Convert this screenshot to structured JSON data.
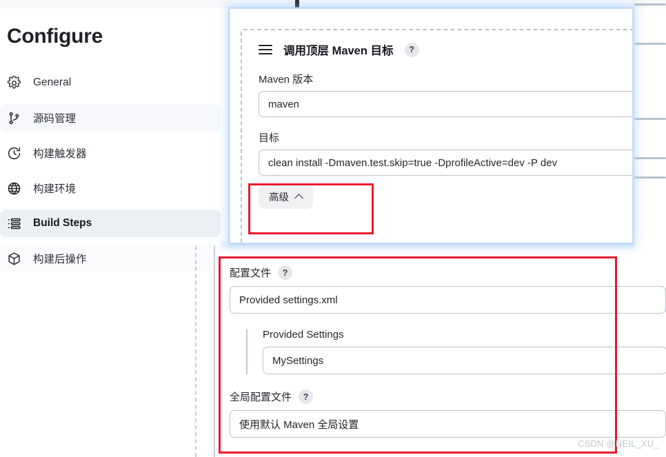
{
  "colors": {
    "accent_red": "#e8192c",
    "panel_focus_blue": "#cfe0f7",
    "selected_nav_bg": "#eceff3",
    "text_primary": "#1f2328",
    "field_border": "#b9c3cc"
  },
  "sidebar": {
    "title": "Configure",
    "items": [
      {
        "label": "General",
        "icon": "gear-icon",
        "selected": false,
        "state": ""
      },
      {
        "label": "源码管理",
        "icon": "git-branch-icon",
        "selected": false,
        "state": "hover-a"
      },
      {
        "label": "构建触发器",
        "icon": "clock-icon",
        "selected": false,
        "state": ""
      },
      {
        "label": "构建环境",
        "icon": "globe-icon",
        "selected": false,
        "state": ""
      },
      {
        "label": "Build Steps",
        "icon": "list-icon",
        "selected": true,
        "state": "selected"
      },
      {
        "label": "构建后操作",
        "icon": "package-icon",
        "selected": false,
        "state": "hover-b"
      }
    ]
  },
  "panel": {
    "drag_handle_icon": "hamburger-drag-icon",
    "title": "调用顶层 Maven 目标",
    "help_badge": "?",
    "fields": [
      {
        "label": "Maven 版本",
        "value": "maven"
      },
      {
        "label": "目标",
        "value": "clean install -Dmaven.test.skip=true -DprofileActive=dev -P dev"
      }
    ],
    "advanced_button": {
      "label": "高级",
      "icon": "chevron-up-icon"
    }
  },
  "ghost_row": {
    "checkbox_label": ""
  },
  "settings_section": {
    "config_file": {
      "label": "配置文件",
      "help_badge": "?",
      "value": "Provided settings.xml"
    },
    "provided_settings": {
      "label": "Provided Settings",
      "value": "MySettings"
    },
    "global_config_file": {
      "label": "全局配置文件",
      "help_badge": "?",
      "value": "使用默认 Maven 全局设置"
    }
  },
  "watermark": {
    "text": "CSDN @NEIL_XU_"
  }
}
